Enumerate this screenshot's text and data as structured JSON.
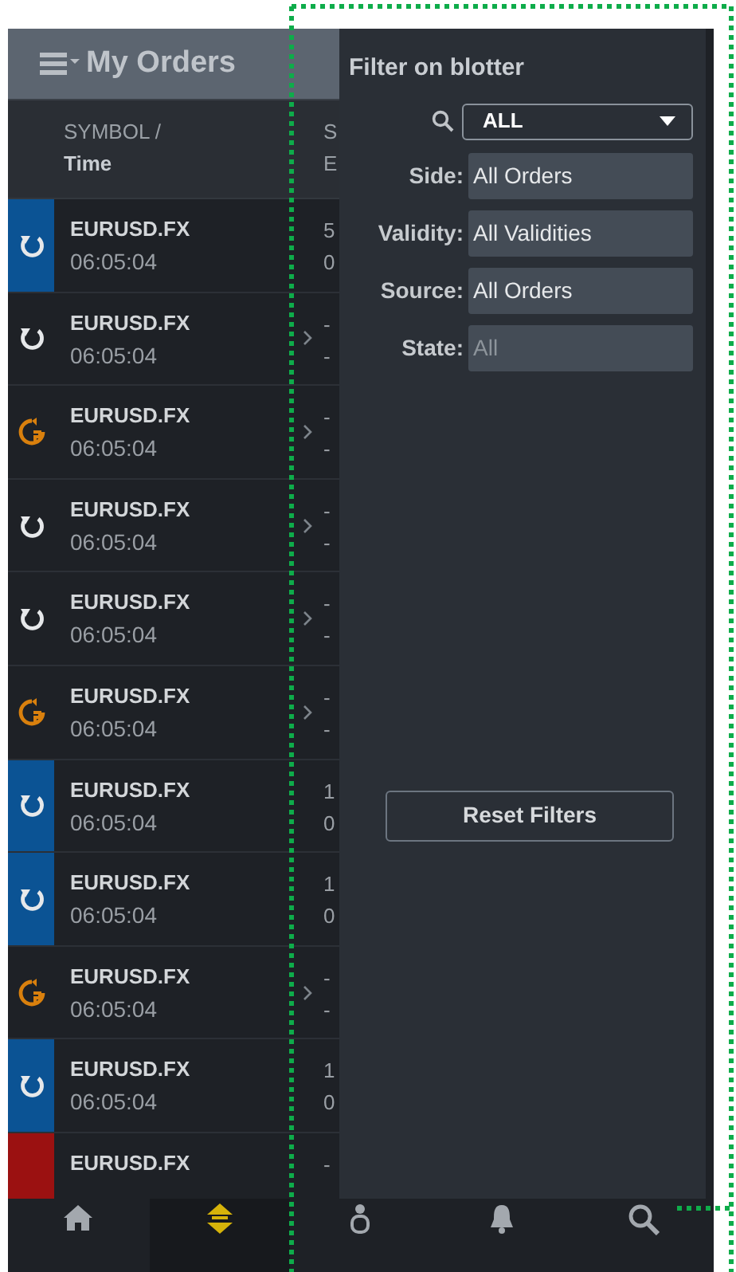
{
  "header": {
    "title": "My Orders"
  },
  "columns": [
    {
      "line1": "SYMBOL /",
      "line2": "Time"
    },
    {
      "line1": "S",
      "line2": "E"
    }
  ],
  "rows": [
    {
      "kind": "active",
      "symbol": "EURUSD.FX",
      "time": "06:05:04",
      "col2_line1": "5",
      "col2_line2": "0",
      "chevron": false
    },
    {
      "kind": "plain",
      "symbol": "EURUSD.FX",
      "time": "06:05:04",
      "col2_line1": "-",
      "col2_line2": "-",
      "chevron": true
    },
    {
      "kind": "partial",
      "symbol": "EURUSD.FX",
      "time": "06:05:04",
      "col2_line1": "-",
      "col2_line2": "-",
      "chevron": true
    },
    {
      "kind": "plain",
      "symbol": "EURUSD.FX",
      "time": "06:05:04",
      "col2_line1": "-",
      "col2_line2": "-",
      "chevron": true
    },
    {
      "kind": "plain",
      "symbol": "EURUSD.FX",
      "time": "06:05:04",
      "col2_line1": "-",
      "col2_line2": "-",
      "chevron": true
    },
    {
      "kind": "partial",
      "symbol": "EURUSD.FX",
      "time": "06:05:04",
      "col2_line1": "-",
      "col2_line2": "-",
      "chevron": true
    },
    {
      "kind": "active",
      "symbol": "EURUSD.FX",
      "time": "06:05:04",
      "col2_line1": "1",
      "col2_line2": "0",
      "chevron": false
    },
    {
      "kind": "active",
      "symbol": "EURUSD.FX",
      "time": "06:05:04",
      "col2_line1": "1",
      "col2_line2": "0",
      "chevron": false
    },
    {
      "kind": "partial",
      "symbol": "EURUSD.FX",
      "time": "06:05:04",
      "col2_line1": "-",
      "col2_line2": "-",
      "chevron": true
    },
    {
      "kind": "active",
      "symbol": "EURUSD.FX",
      "time": "06:05:04",
      "col2_line1": "1",
      "col2_line2": "0",
      "chevron": false
    },
    {
      "kind": "rejected",
      "symbol": "EURUSD.FX",
      "col2_line1": "-",
      "chevron": false
    }
  ],
  "filter_panel": {
    "title": "Filter on blotter",
    "search_select": "ALL",
    "fields": [
      {
        "label": "Side:",
        "value": "All Orders",
        "disabled": false
      },
      {
        "label": "Validity:",
        "value": "All Validities",
        "disabled": false
      },
      {
        "label": "Source:",
        "value": "All Orders",
        "disabled": false
      },
      {
        "label": "State:",
        "value": "All",
        "disabled": true
      }
    ],
    "reset_button": "Reset Filters"
  },
  "nav": [
    {
      "kind": "home",
      "selected": false
    },
    {
      "kind": "orders",
      "selected": true
    },
    {
      "kind": "user",
      "selected": false
    },
    {
      "kind": "bell",
      "selected": false
    },
    {
      "kind": "search",
      "selected": false
    }
  ]
}
